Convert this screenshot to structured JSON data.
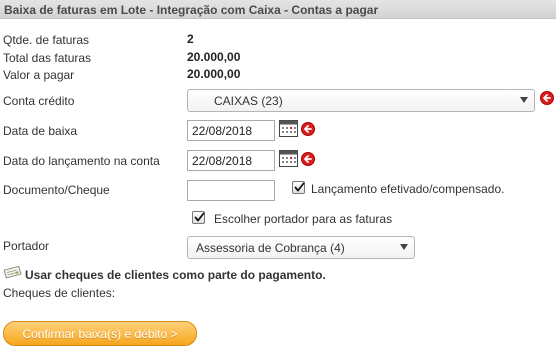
{
  "header": {
    "title": "Baixa de faturas em Lote - Integração com Caixa - Contas a pagar"
  },
  "summary": {
    "qtde_label": "Qtde. de faturas",
    "qtde_value": "2",
    "total_label": "Total das faturas",
    "total_value": "20.000,00",
    "valor_label": "Valor a pagar",
    "valor_value": "20.000,00"
  },
  "form": {
    "conta_label": "Conta crédito",
    "conta_selected": "CAIXAS (23)",
    "data_baixa_label": "Data de baixa",
    "data_baixa_value": "22/08/2018",
    "data_lanc_label": "Data do lançamento na conta",
    "data_lanc_value": "22/08/2018",
    "documento_label": "Documento/Cheque",
    "documento_value": "",
    "lancamento_check_label": "Lançamento efetivado/compensado.",
    "lancamento_checked": true,
    "portador_check_label": "Escolher portador para as faturas",
    "portador_checked": true,
    "portador_label": "Portador",
    "portador_selected": "Assessoria de Cobrança (4)"
  },
  "cheques": {
    "usar_label": "Usar cheques de clientes como parte do pagamento.",
    "clientes_label": "Cheques de clientes:"
  },
  "actions": {
    "confirm_label": "Confirmar baixa(s) e débito >"
  },
  "colors": {
    "accent": "#f6a51d",
    "alert_red": "#d92020"
  }
}
